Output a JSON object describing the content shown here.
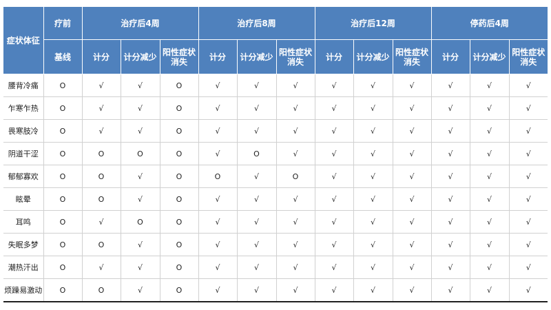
{
  "header": {
    "symptom_col": "症状体征",
    "groups": [
      "疗前",
      "治疗后4周",
      "治疗后8周",
      "治疗后12周",
      "停药后4周"
    ],
    "baseline": "基线",
    "sub": [
      "计分",
      "计分减少",
      "阳性症状\n消失"
    ]
  },
  "rows": [
    {
      "symptom": "腰背冷痛",
      "cells": [
        "O",
        "√",
        "√",
        "O",
        "√",
        "√",
        "√",
        "√",
        "√",
        "√",
        "√",
        "√",
        "√"
      ]
    },
    {
      "symptom": "乍寒乍热",
      "cells": [
        "O",
        "√",
        "√",
        "O",
        "√",
        "√",
        "√",
        "√",
        "√",
        "√",
        "√",
        "√",
        "√"
      ]
    },
    {
      "symptom": "畏寒肢冷",
      "cells": [
        "O",
        "√",
        "√",
        "O",
        "√",
        "√",
        "√",
        "√",
        "√",
        "√",
        "√",
        "√",
        "√"
      ]
    },
    {
      "symptom": "阴道干涩",
      "cells": [
        "O",
        "O",
        "O",
        "O",
        "√",
        "O",
        "√",
        "√",
        "√",
        "√",
        "√",
        "√",
        "√"
      ]
    },
    {
      "symptom": "郁郁寡欢",
      "cells": [
        "O",
        "O",
        "√",
        "O",
        "O",
        "√",
        "O",
        "√",
        "√",
        "√",
        "√",
        "√",
        "√"
      ]
    },
    {
      "symptom": "眩晕",
      "cells": [
        "O",
        "O",
        "√",
        "O",
        "√",
        "√",
        "√",
        "√",
        "√",
        "√",
        "√",
        "√",
        "√"
      ]
    },
    {
      "symptom": "耳鸣",
      "cells": [
        "O",
        "√",
        "O",
        "O",
        "√",
        "√",
        "√",
        "√",
        "√",
        "√",
        "√",
        "√",
        "√"
      ]
    },
    {
      "symptom": "失眠多梦",
      "cells": [
        "O",
        "O",
        "√",
        "O",
        "√",
        "√",
        "√",
        "√",
        "√",
        "√",
        "√",
        "√",
        "√"
      ]
    },
    {
      "symptom": "潮热汗出",
      "cells": [
        "O",
        "√",
        "√",
        "O",
        "√",
        "√",
        "√",
        "√",
        "√",
        "√",
        "√",
        "√",
        "√"
      ]
    },
    {
      "symptom": "烦躁易激动",
      "cells": [
        "O",
        "O",
        "√",
        "O",
        "√",
        "√",
        "√",
        "√",
        "√",
        "√",
        "√",
        "√",
        "√"
      ]
    }
  ]
}
